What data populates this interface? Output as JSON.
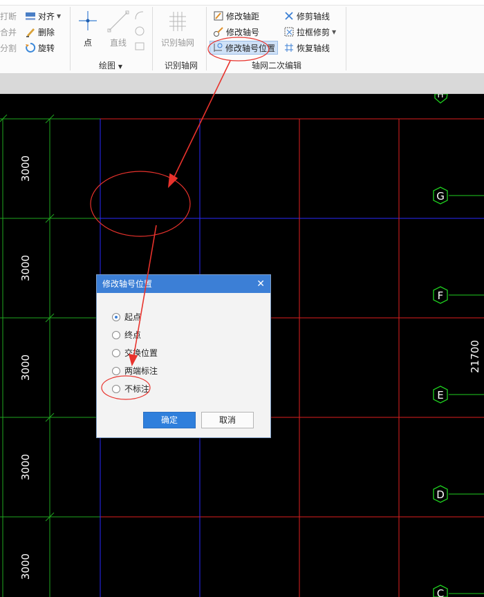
{
  "ribbon": {
    "col0": [
      {
        "label": "打断"
      },
      {
        "label": "合并"
      },
      {
        "label": "分割"
      }
    ],
    "col1": [
      {
        "label": "对齐"
      },
      {
        "label": "删除"
      },
      {
        "label": "旋转"
      }
    ],
    "draw": {
      "point": "点",
      "line": "直线",
      "group": "绘图"
    },
    "identify": {
      "tool": "识别轴网",
      "group": "识别轴网"
    },
    "secondary": {
      "modify_spacing": "修改轴距",
      "modify_label": "修改轴号",
      "modify_label_position": "修改轴号位置",
      "trim_axis": "修剪轴线",
      "box_trim": "拉框修剪",
      "restore_axis": "恢复轴线",
      "group": "轴网二次编辑"
    }
  },
  "canvas": {
    "dims": [
      "3000",
      "3000",
      "3000",
      "3000",
      "3000"
    ],
    "total_dim": "21700",
    "axis_labels": [
      "H",
      "G",
      "F",
      "E",
      "D",
      "C"
    ],
    "colors": {
      "background": "#000000",
      "green": "#00c000",
      "red": "#e02020",
      "blue": "#2a2aff",
      "annotation": "#e8322c"
    }
  },
  "dialog": {
    "title": "修改轴号位置",
    "options": [
      {
        "label": "起点",
        "selected": true
      },
      {
        "label": "终点",
        "selected": false
      },
      {
        "label": "交换位置",
        "selected": false
      },
      {
        "label": "两端标注",
        "selected": false
      },
      {
        "label": "不标注",
        "selected": false
      }
    ],
    "ok_label": "确定",
    "cancel_label": "取消"
  }
}
